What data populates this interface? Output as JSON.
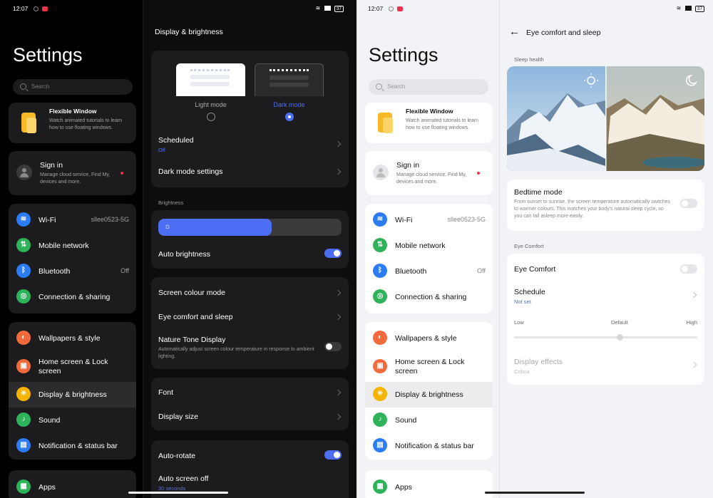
{
  "left": {
    "status": {
      "time": "12:07",
      "battery": "37"
    },
    "sidebar": {
      "title": "Settings",
      "search_placeholder": "Search",
      "promo": {
        "title": "Flexible Window",
        "desc": "Watch animated tutorials to learn how to use floating windows."
      },
      "signin": {
        "title": "Sign in",
        "desc": "Manage cloud service, Find My, devices and more."
      },
      "group1": [
        {
          "label": "Wi-Fi",
          "value": "sllee0523-5G",
          "icon": "wifi-icon",
          "color": "#2b7cf5"
        },
        {
          "label": "Mobile network",
          "value": "",
          "icon": "mobile-network-icon",
          "color": "#2fb35a"
        },
        {
          "label": "Bluetooth",
          "value": "Off",
          "icon": "bluetooth-icon",
          "color": "#2b7cf5"
        },
        {
          "label": "Connection & sharing",
          "value": "",
          "icon": "connection-sharing-icon",
          "color": "#2fb35a"
        }
      ],
      "group2": [
        {
          "label": "Wallpapers & style",
          "icon": "palette-icon",
          "color": "#f26a3b"
        },
        {
          "label": "Home screen & Lock screen",
          "icon": "home-screen-icon",
          "color": "#f26a3b"
        },
        {
          "label": "Display & brightness",
          "icon": "brightness-icon",
          "color": "#f5b400"
        },
        {
          "label": "Sound",
          "icon": "bell-icon",
          "color": "#2fb35a"
        },
        {
          "label": "Notification & status bar",
          "icon": "notification-icon",
          "color": "#2b7cf5"
        }
      ],
      "apps": {
        "label": "Apps",
        "icon": "apps-icon",
        "color": "#2fb35a"
      }
    },
    "main": {
      "title": "Display & brightness",
      "light_mode": "Light mode",
      "dark_mode": "Dark mode",
      "scheduled": "Scheduled",
      "scheduled_value": "Off",
      "dark_mode_settings": "Dark mode settings",
      "brightness_section": "Brightness",
      "brightness_level": 0.62,
      "auto_brightness": "Auto brightness",
      "screen_colour_mode": "Screen colour mode",
      "eye_comfort": "Eye comfort and sleep",
      "nature_tone": "Nature Tone Display",
      "nature_tone_desc": "Automatically adjust screen colour temperature in response to ambient lighting.",
      "font": "Font",
      "display_size": "Display size",
      "auto_rotate": "Auto-rotate",
      "auto_screen_off": "Auto screen off",
      "auto_screen_off_value": "30 seconds"
    }
  },
  "right": {
    "status": {
      "time": "12:07",
      "battery": "37"
    },
    "main": {
      "title": "Eye comfort and sleep",
      "sleep_health": "Sleep health",
      "bedtime_mode": "Bedtime mode",
      "bedtime_desc": "From sunset to sunrise, the screen temperature automatically switches to warmer colours. This matches your body's natural sleep cycle, so you can fall asleep more easily.",
      "eye_comfort_section": "Eye Comfort",
      "eye_comfort": "Eye Comfort",
      "schedule": "Schedule",
      "schedule_value": "Not set",
      "low": "Low",
      "default": "Default",
      "high": "High",
      "display_effects": "Display effects",
      "colour": "Colour"
    }
  },
  "colors": {
    "accent": "#4c6ef5",
    "dark_card": "#1c1c1e",
    "light_card": "#ffffff",
    "notify_dot": "#e8334a"
  }
}
